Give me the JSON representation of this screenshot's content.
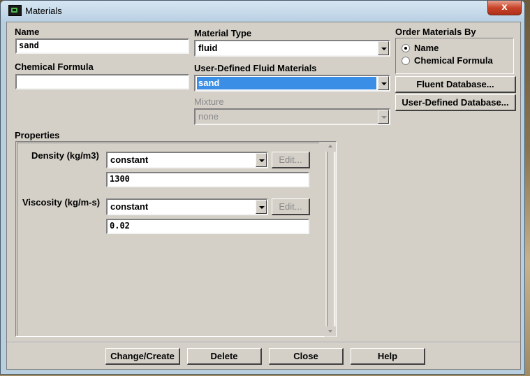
{
  "window": {
    "title": "Materials",
    "close_glyph": "x",
    "icon": "fluent-app-icon"
  },
  "name": {
    "label": "Name",
    "value": "sand"
  },
  "chemical_formula": {
    "label": "Chemical Formula",
    "value": ""
  },
  "material_type": {
    "label": "Material Type",
    "value": "fluid"
  },
  "user_defined": {
    "label": "User-Defined Fluid Materials",
    "value": "sand"
  },
  "mixture": {
    "label": "Mixture",
    "value": "none"
  },
  "order_by": {
    "label": "Order Materials By",
    "options": [
      {
        "label": "Name",
        "checked": true
      },
      {
        "label": "Chemical Formula",
        "checked": false
      }
    ]
  },
  "database_buttons": {
    "fluent": "Fluent Database...",
    "user": "User-Defined Database..."
  },
  "properties": {
    "label": "Properties",
    "density": {
      "label": "Density (kg/m3)",
      "method": "constant",
      "edit": "Edit...",
      "value": "1300"
    },
    "viscosity": {
      "label": "Viscosity (kg/m-s)",
      "method": "constant",
      "edit": "Edit...",
      "value": "0.02"
    }
  },
  "actions": {
    "change_create": "Change/Create",
    "delete": "Delete",
    "close": "Close",
    "help": "Help"
  },
  "colors": {
    "selection": "#3a8ee6",
    "dialog_bg": "#d4d0c8",
    "close_button": "#c8442a"
  }
}
